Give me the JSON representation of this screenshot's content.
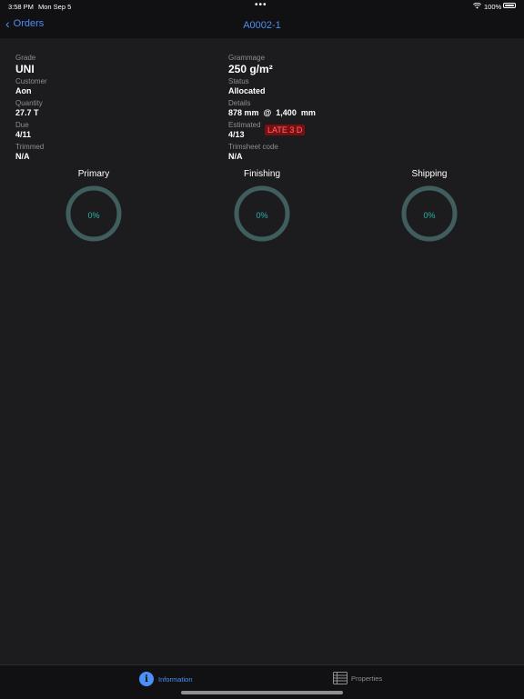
{
  "status_bar": {
    "time": "3:58 PM",
    "date": "Mon Sep 5",
    "battery": "100%"
  },
  "nav": {
    "back_label": "Orders",
    "title": "A0002-1"
  },
  "left_fields": [
    {
      "label": "Grade",
      "value": "UNI"
    },
    {
      "label": "Customer",
      "value": "Aon"
    },
    {
      "label": "Quantity",
      "value": "27.7 T"
    },
    {
      "label": "Due",
      "value": "4/11"
    },
    {
      "label": "Trimmed",
      "value": "N/A"
    }
  ],
  "right_fields": [
    {
      "label": "Grammage",
      "value": "250 g/m²"
    },
    {
      "label": "Status",
      "value": "Allocated"
    },
    {
      "label": "Details",
      "value": "878 mm  @  1,400  mm"
    },
    {
      "label": "Estimated",
      "value": "4/13"
    },
    {
      "label": "Trimsheet code",
      "value": "N/A"
    }
  ],
  "late_badge": "LATE 3 D",
  "gauges": [
    {
      "title": "Primary",
      "value": "0%"
    },
    {
      "title": "Finishing",
      "value": "0%"
    },
    {
      "title": "Shipping",
      "value": "0%"
    }
  ],
  "colors": {
    "accent": "#4b8ff7",
    "gauge_ring": "#3f5e5d",
    "gauge_text": "#2ab4a7",
    "late_bg": "#7a0f12"
  },
  "tabs": [
    {
      "label": "Information",
      "icon": "info-icon",
      "selected": true
    },
    {
      "label": "Properties",
      "icon": "list-icon",
      "selected": false
    }
  ]
}
